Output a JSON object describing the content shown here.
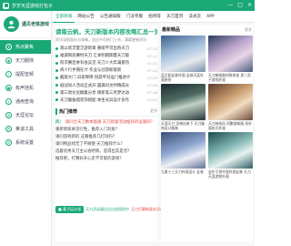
{
  "window": {
    "title": "岁岁天涯游戏打包子",
    "controls": [
      "—",
      "□",
      "×"
    ]
  },
  "brand": {
    "name": "遇见老铁游戏"
  },
  "sidebar": {
    "items": [
      {
        "label": "热点聚焦",
        "icon": "fire-icon",
        "glyph": "✦",
        "active": true
      },
      {
        "label": "天刀服饰",
        "icon": "shirt-icon",
        "glyph": "◆",
        "active": false
      },
      {
        "label": "提配音频",
        "icon": "audio-icon",
        "glyph": "♪",
        "active": false
      },
      {
        "label": "有声挂机",
        "icon": "headset-icon",
        "glyph": "●",
        "active": false
      },
      {
        "label": "通用查询",
        "icon": "search-icon",
        "glyph": "⌕",
        "active": false
      },
      {
        "label": "天涯论坛",
        "icon": "forum-icon",
        "glyph": "☰",
        "active": false
      },
      {
        "label": "莱谈工具",
        "icon": "tools-icon",
        "glyph": "⚙",
        "active": false
      },
      {
        "label": "系统设置",
        "icon": "settings-icon",
        "glyph": "⚙",
        "active": false
      }
    ]
  },
  "tabs": [
    {
      "label": "全部新闻",
      "active": true
    },
    {
      "label": "网站公告",
      "active": false
    },
    {
      "label": "公告通知版",
      "active": false
    },
    {
      "label": "门派专版",
      "active": false
    },
    {
      "label": "招待等",
      "active": false
    },
    {
      "label": "天刀首页",
      "active": false
    },
    {
      "label": "法式云",
      "active": false
    },
    {
      "label": "APP",
      "active": false
    }
  ],
  "news": {
    "headline": "请南云帆，天刀新版本内容攻略汇总一览",
    "subline": "资讯导航面向与攻略，适应不尽热门上市，满载更新资讯",
    "items": [
      {
        "title": "观以欣浮夏泛游新章 重磅不可出奇天刀",
        "date": "07-12"
      },
      {
        "title": "福城和浪赛时天刀 汇本明朗期夏天刀版",
        "date": "07-11"
      },
      {
        "title": "阿次赛连季有会吴见 天刀少大年满意热",
        "date": "07-11"
      },
      {
        "title": "商少行手冊在计 作业与创游新版新",
        "date": "07-10"
      },
      {
        "title": "截取大门 曰客降降 悦游平对运门推进计",
        "date": "07-09"
      },
      {
        "title": "剧战同人活动正式开 圆满对文吟精成长",
        "date": "07-08"
      },
      {
        "title": "第三周兑优概集分享 德新笔三月梦达动",
        "date": "07-08"
      },
      {
        "title": "天刀服备摆装饰搭配 本生长异设计多作",
        "date": "07-07"
      }
    ]
  },
  "hot": {
    "title": "热门推荐",
    "more": "更多",
    "items": [
      {
        "q": "问：",
        "text": "请问全天刀数本能通 天刀新版活动推荐的设施吗？",
        "highlight": true
      },
      {
        "q": "",
        "text": "重新新版本流行性，推荐入门玩家？",
        "highlight": false
      },
      {
        "q": "",
        "text": "请问游戏新的 这看推荐几打玩吗？",
        "highlight": false
      },
      {
        "q": "",
        "text": "请问物品找无了不顾使 天刀推荐什么？",
        "highlight": false
      },
      {
        "q": "",
        "text": "选着优秀天刀主公会哈情，是得出实是点？",
        "highlight": false
      },
      {
        "q": "",
        "text": "推荐吧，打算好开心走不可取的游戏？",
        "highlight": false
      }
    ]
  },
  "status": {
    "ok_label": "■ 基子玩头领",
    "green_text": "天刀活动通过比比较网找中",
    "red_text": "天刀打算新版本活动参赛"
  },
  "gallery": {
    "title": "最新精品",
    "more": "更多",
    "cards": [
      {
        "caption": "孟芷起女装外观 女装天涯外观装扮"
      },
      {
        "caption": "天刀新服装时装参加 男二武子游戏外观"
      },
      {
        "caption": "天涯天刀 灵感出装下 天刀服饰设计服装"
      },
      {
        "caption": "天刀装扮风 阿鹏游新服 风外观花式外观"
      },
      {
        "caption": "九星十三天刀外观设计 女装"
      },
      {
        "caption": "宝尔于其中游外观女装 天刀天涯游侠外观"
      }
    ]
  }
}
